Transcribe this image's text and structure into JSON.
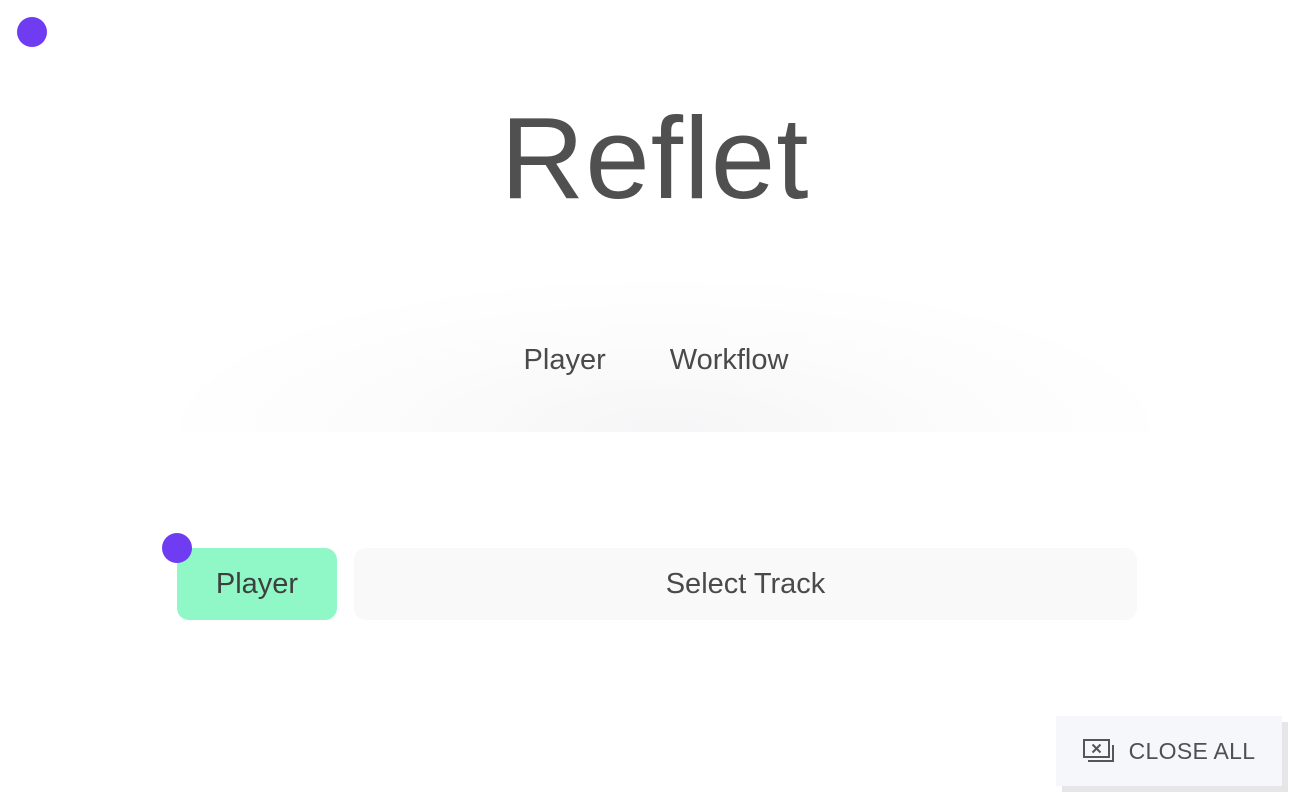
{
  "app": {
    "title": "Reflet"
  },
  "nav": {
    "items": [
      {
        "label": "Player"
      },
      {
        "label": "Workflow"
      }
    ]
  },
  "controls": {
    "player_button_label": "Player",
    "track_select_label": "Select Track"
  },
  "footer": {
    "close_all_label": "CLOSE ALL",
    "close_all_icon": "close-windows-icon"
  },
  "colors": {
    "accent_dot": "#6f3cf2",
    "player_button_bg": "#8ff8c6",
    "text": "#4a4a4a"
  }
}
